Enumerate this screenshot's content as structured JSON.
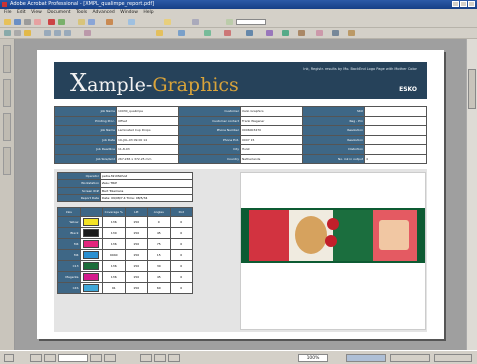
{
  "window": {
    "title": "Adobe Acrobat Professional - [XMPL_qualimpe_report.pdf]"
  },
  "menu": [
    "File",
    "Edit",
    "View",
    "Document",
    "Tools",
    "Advanced",
    "Window",
    "Help"
  ],
  "toolbar": {
    "zoom": "100%"
  },
  "report": {
    "logo_letter": "X",
    "logo_rest": "ample-",
    "logo_brand": "Graphics",
    "subtitle": "Ink, Registr. results by Mo. BackEnd Logo Page with Mother Color",
    "esko": "ESKO"
  },
  "info_rows": [
    [
      "Job Name",
      "10030_qualimpe",
      "Customer",
      "Xalio Graphics",
      "SKU",
      ""
    ],
    [
      "Printing Proc.",
      "Offset",
      "Customer contact",
      "Frank Wagener",
      "Reg - Prn",
      ""
    ],
    [
      "Job Name",
      "Laminated Cup Drops",
      "Phone Number",
      "0006003470",
      "Resolution",
      ""
    ],
    [
      "Job Date",
      "19-JUL-03 09:00 14",
      "Phone Ext.",
      "0007 15",
      "Resolution",
      ""
    ],
    [
      "Job Deadline",
      "11-8-03",
      "City",
      "Hulst",
      "Distortion",
      ""
    ],
    [
      "Job Size/Grid",
      "267.265 x 372.25 mm",
      "Country",
      "Netherlands",
      "No. ink in output",
      "4"
    ]
  ],
  "operator_rows": [
    [
      "Operator",
      "petra.MrcMsthod"
    ],
    [
      "Workstation",
      "ZeLu TRiP"
    ],
    [
      "Screen ID#",
      "Bart Tolemans"
    ],
    [
      "Report Date",
      "Date: 09/08/7.4 Time: 08/5/34"
    ]
  ],
  "ink_headers": [
    "Inks",
    "Coverage %",
    "LPI",
    "Angles",
    "Dot"
  ],
  "inks": [
    {
      "name": "Yellow",
      "color": "#f4e326",
      "vals": [
        "136",
        "150",
        "0",
        "0"
      ]
    },
    {
      "name": "Black",
      "color": "#1a1a1a",
      "vals": [
        "130",
        "150",
        "45",
        "0"
      ]
    },
    {
      "name": "M4",
      "color": "#e4247c",
      "vals": [
        "136",
        "150",
        "75",
        "0"
      ]
    },
    {
      "name": "M4",
      "color": "#2b8fd0",
      "vals": [
        "9040",
        "150",
        "15",
        "0"
      ]
    },
    {
      "name": "C13",
      "color": "#1c6d3a",
      "vals": [
        "136",
        "150",
        "30",
        "0"
      ]
    },
    {
      "name": "Magenta",
      "color": "#d41b8c",
      "vals": [
        "136",
        "150",
        "45",
        "0"
      ]
    },
    {
      "name": "C4S",
      "color": "#3fa7d8",
      "vals": [
        "91",
        "150",
        "60",
        "0"
      ]
    }
  ]
}
